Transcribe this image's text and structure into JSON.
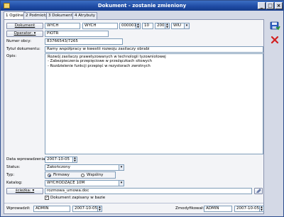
{
  "window": {
    "title": "Dokument - zostanie zmieniony",
    "minimize": "_",
    "maximize": "□",
    "close": "×"
  },
  "tabs": [
    {
      "label": "1 Ogólne"
    },
    {
      "label": "2 Podmioty"
    },
    {
      "label": "3 Dokumenty"
    },
    {
      "label": "4 Atrybuty"
    }
  ],
  "document": {
    "button_label": "Dokument",
    "type_code": "WYCH",
    "type_code2": "WYCH",
    "number": "000001",
    "month": "10",
    "year": "2007",
    "suffix": "WIU",
    "dropdown_glyph": "▾"
  },
  "operator": {
    "button_label": "Operator:",
    "code": "PIOTR",
    "dropdown_glyph": "▾"
  },
  "external_number": {
    "label": "Numer obcy:",
    "value": "83766543/7265"
  },
  "title_field": {
    "label": "Tytuł dokumentu:",
    "value": "Ramy współpracy w kwestii rozwoju zasilaczy obrabi"
  },
  "description": {
    "label": "Opis:",
    "lines": [
      "Rozwój zasilaczy prawetyzowanych w technologii tyzowniotowej",
      "- Zabezpieczenia przepięciowe w przeźączkach sitowych",
      "- Rozdzielenie funkcji przepięć w rezystorach zwrotnych"
    ]
  },
  "entry_date": {
    "label": "Data wprowadzenia:",
    "value": "2007-10-05"
  },
  "status": {
    "label": "Status:",
    "value": "Zakończony"
  },
  "type": {
    "label": "Typ:",
    "option_company": "Firmowy",
    "option_shared": "Wspólny",
    "selected": "Firmowy"
  },
  "catalog": {
    "label": "Katalog:",
    "value": "WYCHODZĄCE 10M"
  },
  "path": {
    "button_label": "ścieżka:",
    "value": "rozmowa_umowa.doc"
  },
  "saved_checkbox": {
    "label": "Dokument zapisany w bazie",
    "checked": true
  },
  "footer": {
    "entered_label": "Wprowadził:",
    "entered_by": "ADMIN",
    "entered_date": "2007-10-05",
    "modified_label": "Zmodyfikował:",
    "modified_by": "ADMIN",
    "modified_date": "2007-10-05"
  },
  "side_buttons": {
    "save_icon": "save-icon",
    "cancel_icon": "cancel-icon"
  },
  "colors": {
    "title_bar": "#1e4aa3",
    "cancel_red": "#d22020",
    "save_blue": "#2a5cc0"
  }
}
